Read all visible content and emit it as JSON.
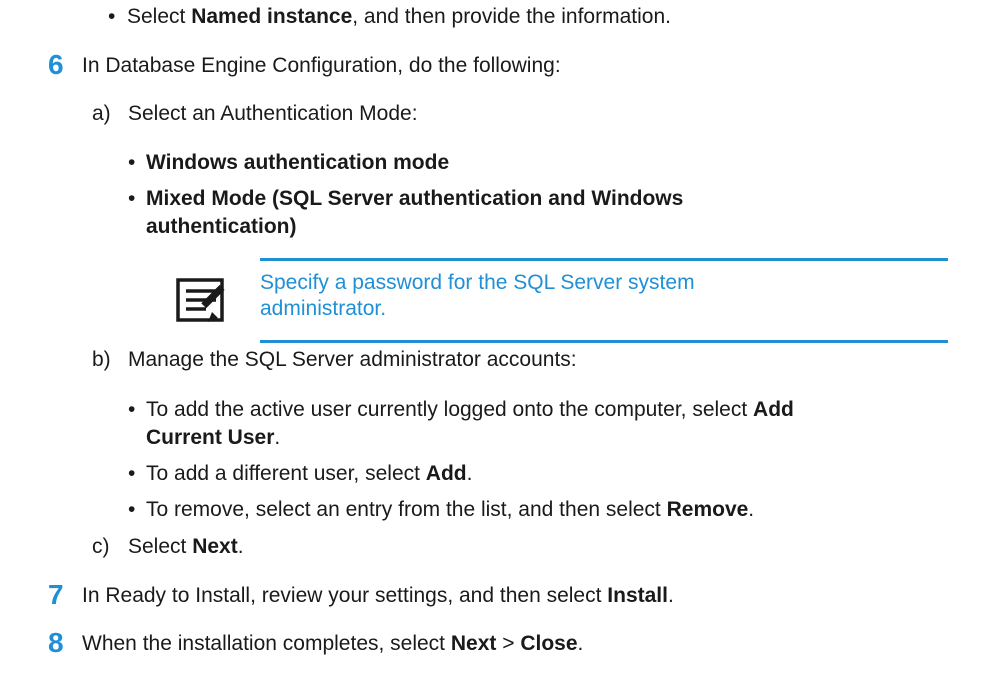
{
  "intro_bullet": {
    "pre": "Select ",
    "bold": "Named instance",
    "post": ", and then provide the information."
  },
  "step6": {
    "number": "6",
    "text": "In Database Engine Configuration, do the following:",
    "a": {
      "letter": "a)",
      "text": "Select an Authentication Mode:",
      "options": [
        "Windows authentication mode",
        "Mixed Mode (SQL Server authentication and Windows",
        "authentication)"
      ],
      "note_line1": "Specify a password for the SQL Server system",
      "note_line2": "administrator."
    },
    "b": {
      "letter": "b)",
      "text": "Manage the SQL Server administrator accounts:",
      "item1_pre": "To add the active user currently logged onto the computer, select ",
      "item1_bold1": "Add",
      "item1_bold2": "Current User",
      "item1_post": ".",
      "item2_pre": "To add a different user, select ",
      "item2_bold": "Add",
      "item2_post": ".",
      "item3_pre": "To remove, select an entry from the list, and then select ",
      "item3_bold": "Remove",
      "item3_post": "."
    },
    "c": {
      "letter": "c)",
      "pre": "Select ",
      "bold": "Next",
      "post": "."
    }
  },
  "step7": {
    "number": "7",
    "pre": "In Ready to Install, review your settings, and then select ",
    "bold": "Install",
    "post": "."
  },
  "step8": {
    "number": "8",
    "pre": "When the installation completes, select ",
    "bold1": "Next",
    "mid": " > ",
    "bold2": "Close",
    "post": "."
  },
  "colors": {
    "accent": "#1f8fd6",
    "text": "#1a1a1a"
  },
  "icons": {
    "note": "note-icon"
  }
}
